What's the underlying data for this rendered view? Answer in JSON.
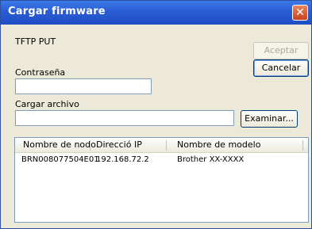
{
  "window": {
    "title": "Cargar firmware"
  },
  "mode_label": "TFTP PUT",
  "buttons": {
    "accept": "Aceptar",
    "cancel": "Cancelar",
    "browse": "Examinar..."
  },
  "password": {
    "label": "Contraseña",
    "value": ""
  },
  "upload_file": {
    "label": "Cargar archivo",
    "value": ""
  },
  "table": {
    "columns": [
      "Nombre de nodo",
      "Direcció IP",
      "Nombre de modelo"
    ],
    "rows": [
      [
        "BRN008077504E01",
        "192.168.72.2",
        "Brother XX-XXXX"
      ]
    ]
  },
  "colors": {
    "titlebar": "#2b5fd6",
    "window_bg": "#ece9d8"
  },
  "icons": {
    "close": "close-icon"
  }
}
